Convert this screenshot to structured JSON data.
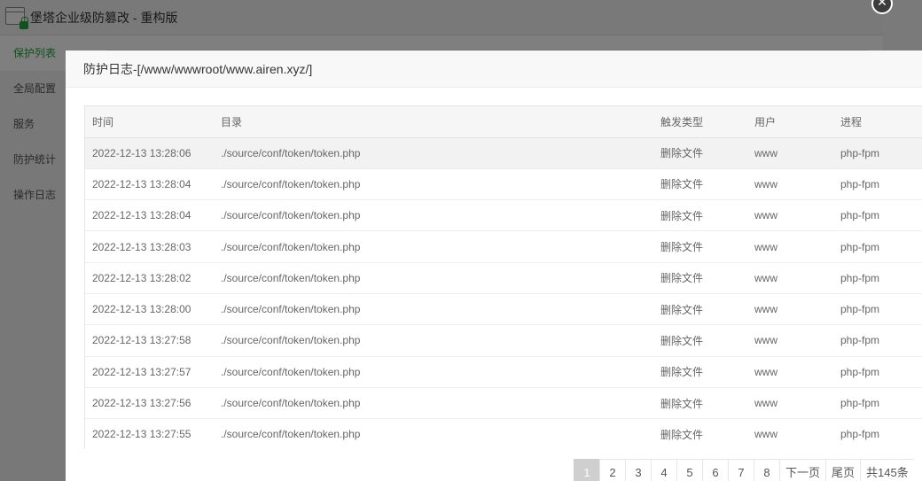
{
  "app": {
    "title": "堡塔企业级防篡改 - 重构版",
    "sidebar": [
      {
        "label": "保护列表",
        "active": true
      },
      {
        "label": "全局配置",
        "active": false
      },
      {
        "label": "服务",
        "active": false
      },
      {
        "label": "防护统计",
        "active": false
      },
      {
        "label": "操作日志",
        "active": false
      }
    ]
  },
  "dialog": {
    "title": "防护日志-[/www/wwwroot/www.airen.xyz/]",
    "close_icon": "close-icon",
    "table": {
      "headers": {
        "time": "时间",
        "dir": "目录",
        "type": "触发类型",
        "user": "用户",
        "process": "进程"
      },
      "rows": [
        {
          "time": "2022-12-13 13:28:06",
          "dir": "./source/conf/token/token.php",
          "type": "删除文件",
          "user": "www",
          "process": "php-fpm"
        },
        {
          "time": "2022-12-13 13:28:04",
          "dir": "./source/conf/token/token.php",
          "type": "删除文件",
          "user": "www",
          "process": "php-fpm"
        },
        {
          "time": "2022-12-13 13:28:04",
          "dir": "./source/conf/token/token.php",
          "type": "删除文件",
          "user": "www",
          "process": "php-fpm"
        },
        {
          "time": "2022-12-13 13:28:03",
          "dir": "./source/conf/token/token.php",
          "type": "删除文件",
          "user": "www",
          "process": "php-fpm"
        },
        {
          "time": "2022-12-13 13:28:02",
          "dir": "./source/conf/token/token.php",
          "type": "删除文件",
          "user": "www",
          "process": "php-fpm"
        },
        {
          "time": "2022-12-13 13:28:00",
          "dir": "./source/conf/token/token.php",
          "type": "删除文件",
          "user": "www",
          "process": "php-fpm"
        },
        {
          "time": "2022-12-13 13:27:58",
          "dir": "./source/conf/token/token.php",
          "type": "删除文件",
          "user": "www",
          "process": "php-fpm"
        },
        {
          "time": "2022-12-13 13:27:57",
          "dir": "./source/conf/token/token.php",
          "type": "删除文件",
          "user": "www",
          "process": "php-fpm"
        },
        {
          "time": "2022-12-13 13:27:56",
          "dir": "./source/conf/token/token.php",
          "type": "删除文件",
          "user": "www",
          "process": "php-fpm"
        },
        {
          "time": "2022-12-13 13:27:55",
          "dir": "./source/conf/token/token.php",
          "type": "删除文件",
          "user": "www",
          "process": "php-fpm"
        }
      ]
    },
    "pagination": {
      "pages": [
        "1",
        "2",
        "3",
        "4",
        "5",
        "6",
        "7",
        "8"
      ],
      "current": "1",
      "next_label": "下一页",
      "last_label": "尾页",
      "total_label": "共145条"
    }
  },
  "colors": {
    "accent": "#20a53a",
    "overlay": "#000000",
    "current_page": "#cfcfcf"
  }
}
